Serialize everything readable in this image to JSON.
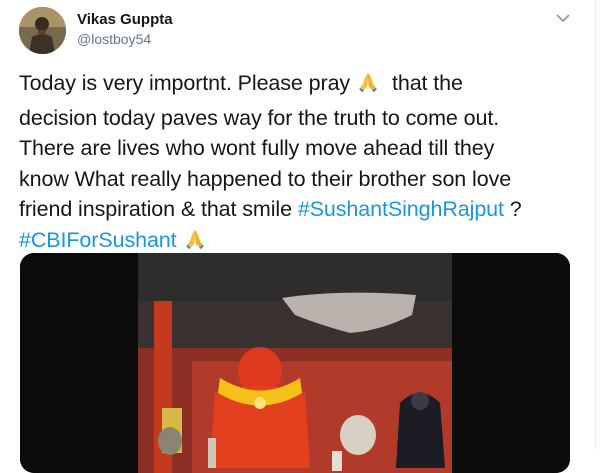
{
  "tweet": {
    "author_name": "Vikas Guppta",
    "author_handle": "@lostboy54",
    "lines": [
      [
        "Today is very importnt. Please pray",
        " that the"
      ],
      [
        "decision today paves way for the truth to come out."
      ],
      [
        "There are lives who wont fully move ahead till they"
      ],
      [
        "know What really happened to their brother son love"
      ],
      [
        "friend inspiration & that smile ",
        "#SushantSinghRajput",
        " ?"
      ],
      [
        "#CBIForSushant"
      ]
    ]
  },
  "icons": {
    "more": "chevron-down-icon",
    "pray": "folded-hands-emoji"
  },
  "colors": {
    "text": "#14171a",
    "secondary": "#657786",
    "link": "#1b95e0",
    "emoji": "#f4c03e"
  }
}
